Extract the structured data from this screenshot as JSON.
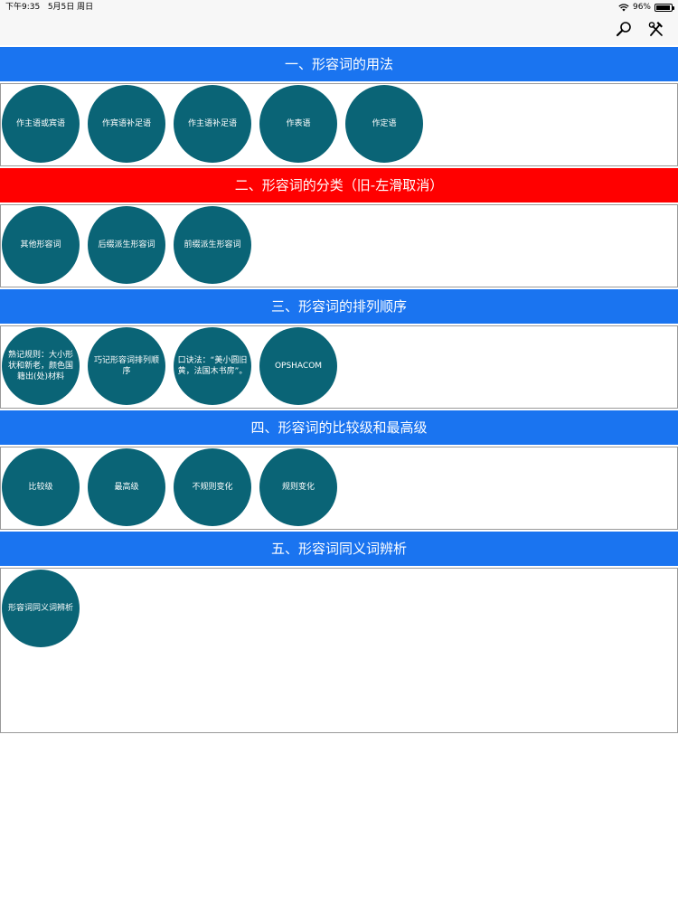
{
  "status_bar": {
    "time": "下午9:35",
    "date": "5月5日 周日",
    "battery": "96%",
    "battery_level": 0.96
  },
  "nav": {
    "icons": [
      "search-icon",
      "tools-icon"
    ]
  },
  "colors": {
    "header_blue": "#1a74f0",
    "header_red": "#ff0000",
    "circle": "#0a6476"
  },
  "sections": [
    {
      "title": "一、形容词的用法",
      "items": [
        "作主语或宾语",
        "作宾语补足语",
        "作主语补足语",
        "作表语",
        "作定语"
      ]
    },
    {
      "title": "二、形容词的分类（旧-左滑取消）",
      "items": [
        "其他形容词",
        "后缀派生形容词",
        "前缀派生形容词"
      ]
    },
    {
      "title": "三、形容词的排列顺序",
      "items": [
        "熟记规则：大小形状和新老，颜色国籍出(处)材料",
        "巧记形容词排列顺序",
        "口诀法：“美小圆旧黄，法国木书房”。",
        "OPSHACOM"
      ]
    },
    {
      "title": "四、形容词的比较级和最高级",
      "items": [
        "比较级",
        "最高级",
        "不规则变化",
        "规则变化"
      ]
    },
    {
      "title": "五、形容词同义词辨析",
      "items": [
        "形容词同义词辨析"
      ]
    }
  ]
}
